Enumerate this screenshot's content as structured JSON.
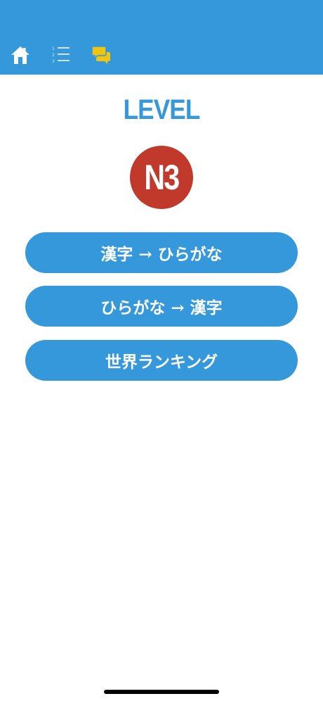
{
  "header": {
    "background_color": "#3498db",
    "icons": [
      "home-icon",
      "numbered-list-icon",
      "chat-icon"
    ],
    "active_icon_color": "#f1c40f"
  },
  "main": {
    "title": "LEVEL",
    "level_badge": "N3",
    "badge_color": "#c0392b",
    "buttons": [
      {
        "label": "漢字 → ひらがな"
      },
      {
        "label": "ひらがな → 漢字"
      },
      {
        "label": "世界ランキング"
      }
    ]
  }
}
